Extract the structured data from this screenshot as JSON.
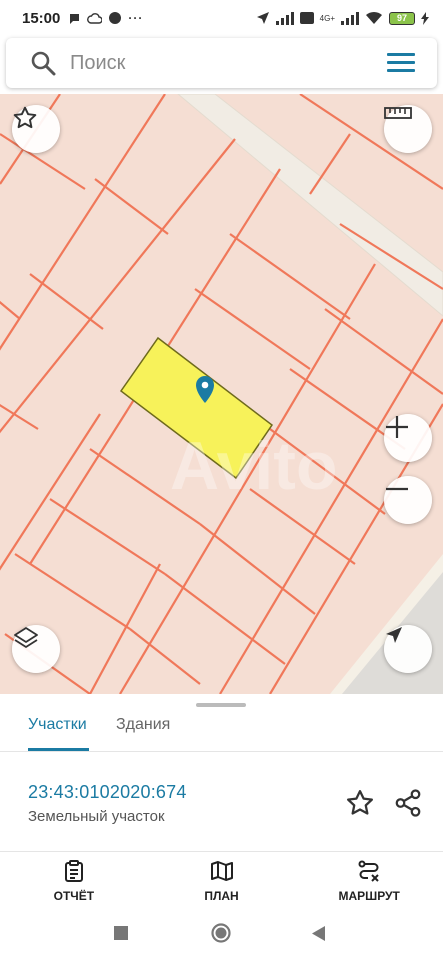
{
  "status_bar": {
    "time": "15:00",
    "battery": "97",
    "network": "4G+"
  },
  "search": {
    "placeholder": "Поиск"
  },
  "map": {
    "watermark": "Avito"
  },
  "tabs": [
    {
      "label": "Участки",
      "active": true
    },
    {
      "label": "Здания",
      "active": false
    }
  ],
  "parcel": {
    "cadastral_number": "23:43:0102020:674",
    "type": "Земельный участок"
  },
  "actions": {
    "report": "ОТЧЁТ",
    "plan": "ПЛАН",
    "route": "МАРШРУТ"
  },
  "colors": {
    "accent": "#1b7ba3",
    "map_background": "#f5ded3",
    "parcel_line": "#f0785a",
    "selected_parcel": "#f7f25a"
  }
}
